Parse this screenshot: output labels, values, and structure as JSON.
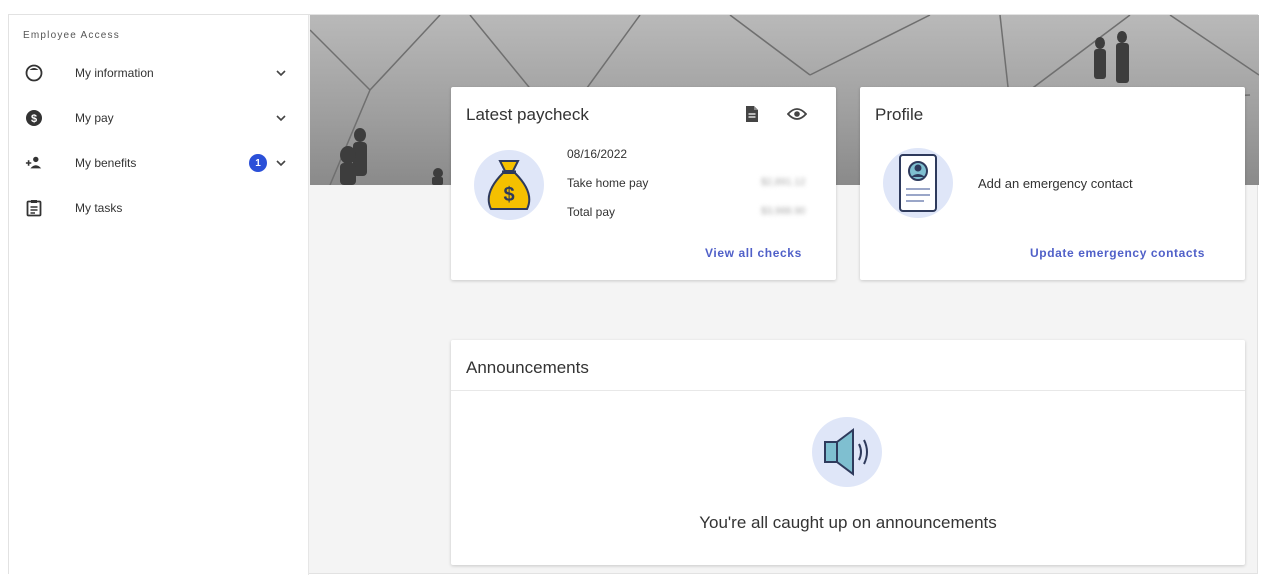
{
  "sidebar": {
    "title": "Employee Access",
    "items": [
      {
        "label": "My information",
        "icon": "person-circle-icon",
        "has_chevron": true
      },
      {
        "label": "My pay",
        "icon": "dollar-circle-icon",
        "has_chevron": true
      },
      {
        "label": "My benefits",
        "icon": "person-add-icon",
        "has_chevron": true,
        "badge": "1"
      },
      {
        "label": "My tasks",
        "icon": "clipboard-icon",
        "has_chevron": false
      }
    ]
  },
  "paycheck": {
    "title": "Latest paycheck",
    "date": "08/16/2022",
    "take_home_label": "Take home pay",
    "take_home_value": "$2,891.12",
    "total_label": "Total pay",
    "total_value": "$3,988.90",
    "link": "View all checks"
  },
  "profile": {
    "title": "Profile",
    "message": "Add an emergency contact",
    "link": "Update emergency contacts"
  },
  "announcements": {
    "title": "Announcements",
    "message": "You're all caught up on announcements"
  },
  "colors": {
    "accent": "#5060c8",
    "badge": "#2b50d8",
    "money_bag": "#f5c000",
    "icon_circle": "#dfe6f8"
  }
}
